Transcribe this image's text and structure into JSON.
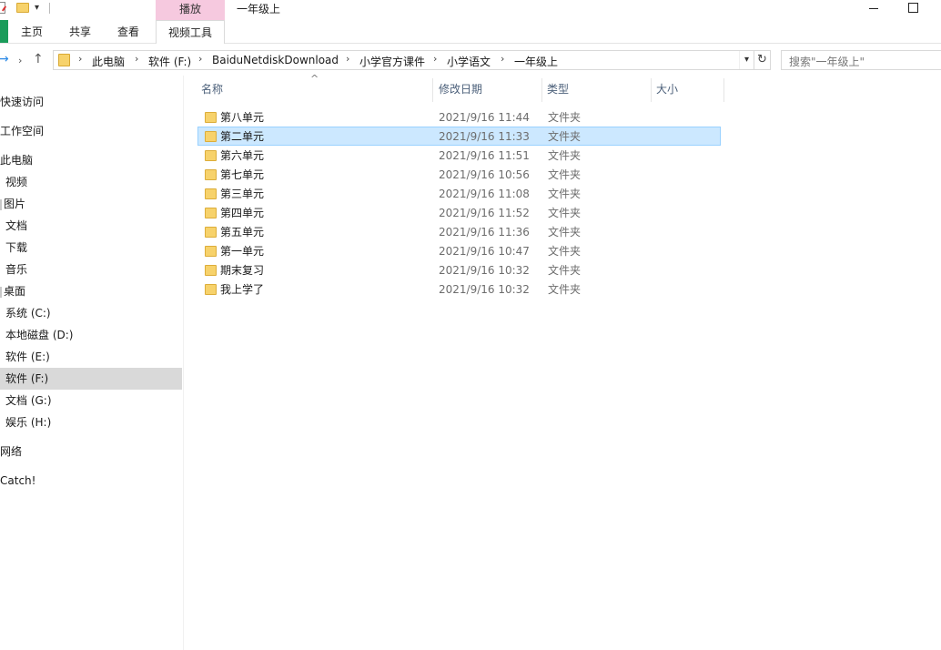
{
  "window": {
    "title": "一年级上",
    "context_tab": "播放"
  },
  "ribbon": {
    "tabs": [
      "主页",
      "共享",
      "查看",
      "视频工具"
    ]
  },
  "address_bar": {
    "breadcrumbs": [
      "此电脑",
      "软件 (F:)",
      "BaiduNetdiskDownload",
      "小学官方课件",
      "小学语文",
      "一年级上"
    ],
    "dropdown_icon": "chevron-down-icon",
    "refresh_icon": "refresh-icon"
  },
  "search": {
    "placeholder": "搜索\"一年级上\""
  },
  "sidebar": {
    "items": [
      {
        "label": "快速访问",
        "level": 0
      },
      {
        "label": "工作空间",
        "level": 0
      },
      {
        "label": "此电脑",
        "level": 0
      },
      {
        "label": "视频",
        "level": 1
      },
      {
        "label": "图片",
        "level": 1
      },
      {
        "label": "文档",
        "level": 1
      },
      {
        "label": "下载",
        "level": 1
      },
      {
        "label": "音乐",
        "level": 1
      },
      {
        "label": "桌面",
        "level": 1
      },
      {
        "label": "系统 (C:)",
        "level": 1
      },
      {
        "label": "本地磁盘 (D:)",
        "level": 1
      },
      {
        "label": "软件 (E:)",
        "level": 1
      },
      {
        "label": "软件 (F:)",
        "level": 1,
        "selected": true
      },
      {
        "label": "文档 (G:)",
        "level": 1
      },
      {
        "label": "娱乐 (H:)",
        "level": 1
      },
      {
        "label": "网络",
        "level": 0
      },
      {
        "label": "Catch!",
        "level": 0
      }
    ]
  },
  "columns": {
    "name": "名称",
    "date": "修改日期",
    "type": "类型",
    "size": "大小"
  },
  "files": [
    {
      "name": "第八单元",
      "date": "2021/9/16 11:44",
      "type": "文件夹"
    },
    {
      "name": "第二单元",
      "date": "2021/9/16 11:33",
      "type": "文件夹",
      "selected": true
    },
    {
      "name": "第六单元",
      "date": "2021/9/16 11:51",
      "type": "文件夹"
    },
    {
      "name": "第七单元",
      "date": "2021/9/16 10:56",
      "type": "文件夹"
    },
    {
      "name": "第三单元",
      "date": "2021/9/16 11:08",
      "type": "文件夹"
    },
    {
      "name": "第四单元",
      "date": "2021/9/16 11:52",
      "type": "文件夹"
    },
    {
      "name": "第五单元",
      "date": "2021/9/16 11:36",
      "type": "文件夹"
    },
    {
      "name": "第一单元",
      "date": "2021/9/16 10:47",
      "type": "文件夹"
    },
    {
      "name": "期末复习",
      "date": "2021/9/16 10:32",
      "type": "文件夹"
    },
    {
      "name": "我上学了",
      "date": "2021/9/16 10:32",
      "type": "文件夹"
    }
  ],
  "colors": {
    "selection_bg": "#cce8ff",
    "selection_border": "#99d1ff",
    "sidebar_selected": "#d9d9d9",
    "context_tab": "#f6c9df",
    "file_tab": "#1a9c5a",
    "folder": "#f7d26b"
  }
}
